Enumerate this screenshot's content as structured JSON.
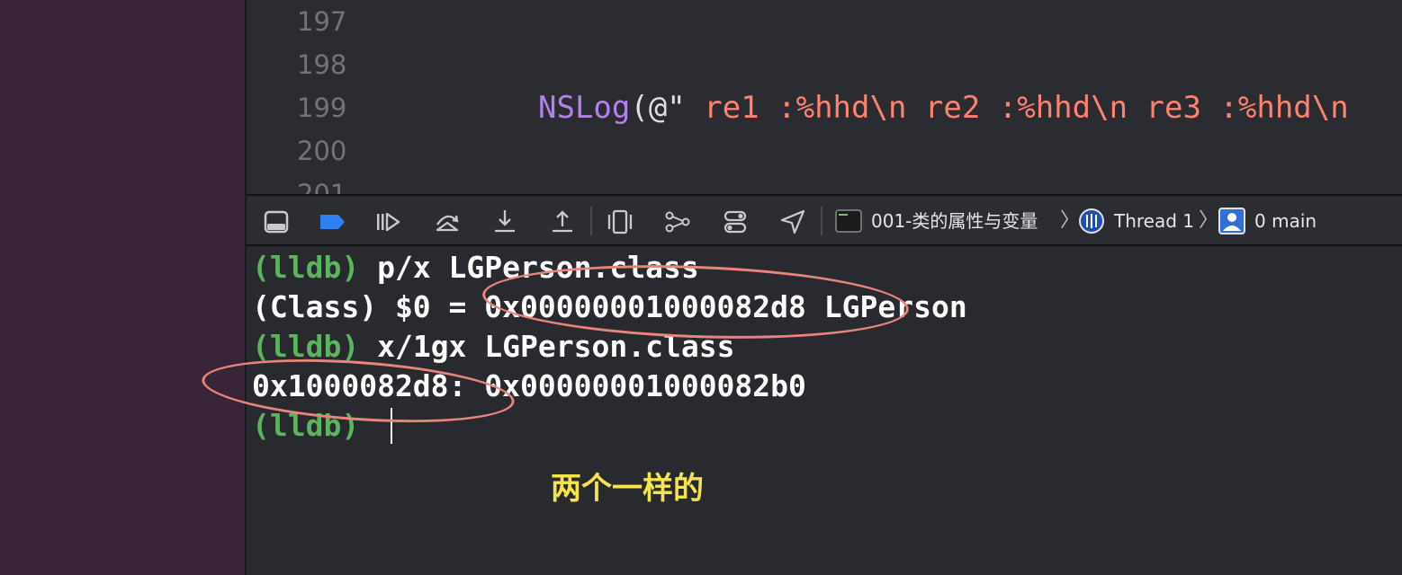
{
  "editor": {
    "lines": [
      {
        "number": "197",
        "code": ""
      },
      {
        "number": "198",
        "code": ""
      },
      {
        "number": "199",
        "func": "NSLog",
        "open": "(@\"",
        "string": " re1 :%hhd\\n re2 :%hhd\\n re3 :%hhd\\n"
      },
      {
        "number": "200",
        "code": ""
      },
      {
        "number": "201",
        "code": ""
      }
    ]
  },
  "debug_bar": {
    "icons": [
      "hide-console-icon",
      "breakpoints-toggle-icon",
      "continue-icon",
      "step-over-icon",
      "step-into-icon",
      "step-out-icon",
      "view-hierarchy-icon",
      "memory-graph-icon",
      "environment-overrides-icon",
      "simulate-location-icon"
    ],
    "breadcrumb": {
      "target": "001-类的属性与变量",
      "thread": "Thread 1",
      "frame": "0 main"
    }
  },
  "console": {
    "lines": [
      {
        "prompt": "(lldb)",
        "text": " p/x LGPerson.class"
      },
      {
        "prompt": "",
        "text": "(Class) $0 = 0x00000001000082d8 LGPerson"
      },
      {
        "prompt": "(lldb)",
        "text": " x/1gx LGPerson.class"
      },
      {
        "prompt": "",
        "text": "0x1000082d8: 0x00000001000082b0"
      },
      {
        "prompt": "(lldb)",
        "text": " "
      }
    ],
    "annotation": "两个一样的"
  },
  "colors": {
    "prompt": "#5db45e",
    "annotation": "#f5e44a",
    "highlight_ellipse": "#e8847c",
    "string_literal": "#ff8170",
    "function_name": "#b281eb"
  }
}
